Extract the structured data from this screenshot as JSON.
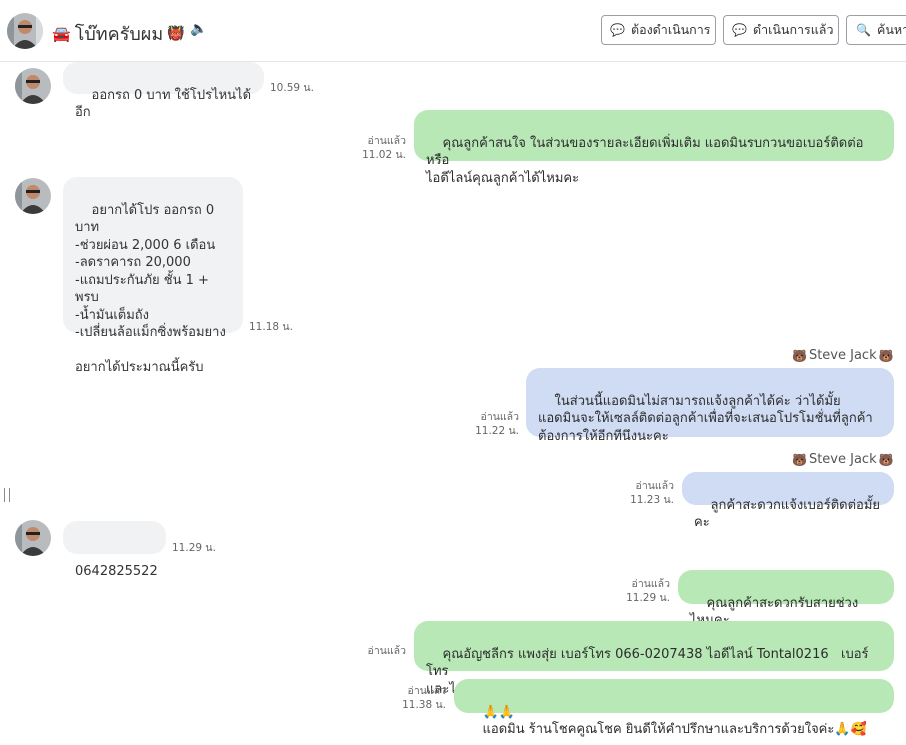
{
  "header": {
    "title": "โบ๊ทครับผม",
    "btn_todo": "ต้องดำเนินการ",
    "btn_done": "ดำเนินการแล้ว",
    "btn_search": "ค้นหา"
  },
  "messages": [
    {
      "text": "ออกรถ 0 บาท ใช้โปรไหนได้อีก",
      "time": "10.59 น."
    },
    {
      "text": "คุณลูกค้าสนใจ ในส่วนของรายละเอียดเพิ่มเติม แอดมินรบกวนขอเบอร์ติดต่อ หรือ\nไอดีไลน์คุณลูกค้าได้ไหมคะ",
      "read": "อ่านแล้ว",
      "time": "11.02 น."
    },
    {
      "text": "อยากได้โปร ออกรถ 0 บาท\n-ช่วยผ่อน 2,000 6 เดือน\n-ลดราคารถ 20,000\n-แถมประกันภัย ชั้น 1 + พรบ\n-น้ำมันเต็มถัง\n-เปลี่ยนล้อแม็กซิ่งพร้อมยาง\n\nอยากได้ประมาณนี้ครับ",
      "time": "11.18 น."
    },
    {
      "sender": "Steve Jack",
      "text": "ในส่วนนี้แอดมินไม่สามารถแจ้งลูกค้าได้ค่ะ ว่าได้มั้ย\nแอดมินจะให้เซลล์ติดต่อลูกค้าเพื่อที่จะเสนอโปรโมชั่นที่ลูกค้า\nต้องการให้อีกทีนึงนะคะ",
      "read": "อ่านแล้ว",
      "time": "11.22 น."
    },
    {
      "sender": "Steve Jack",
      "text": "ลูกค้าสะดวกแจ้งเบอร์ติดต่อมั้ยคะ",
      "read": "อ่านแล้ว",
      "time": "11.23 น."
    },
    {
      "text": "0642825522",
      "time": "11.29 น."
    },
    {
      "text": "คุณลูกค้าสะดวกรับสายช่วงไหนคะ",
      "read": "อ่านแล้ว",
      "time": "11.29 น."
    },
    {
      "text": "คุณอัญชลีกร แพงสุ่ย เบอร์โทร 066-0207438 ไอดีไลน์ Tontal0216   เบอร์โทร\nและไอดีไลน์เซลล์ที่จะดูแลคุณลูกค้านะคะ",
      "read": "อ่านแล้ว"
    },
    {
      "text": "แอดมิน ร้านโชคคูณโชค ยินดีให้คำปรึกษาและบริการด้วยใจค่ะ",
      "read": "อ่านแล้ว",
      "time": "11.38 น."
    }
  ]
}
